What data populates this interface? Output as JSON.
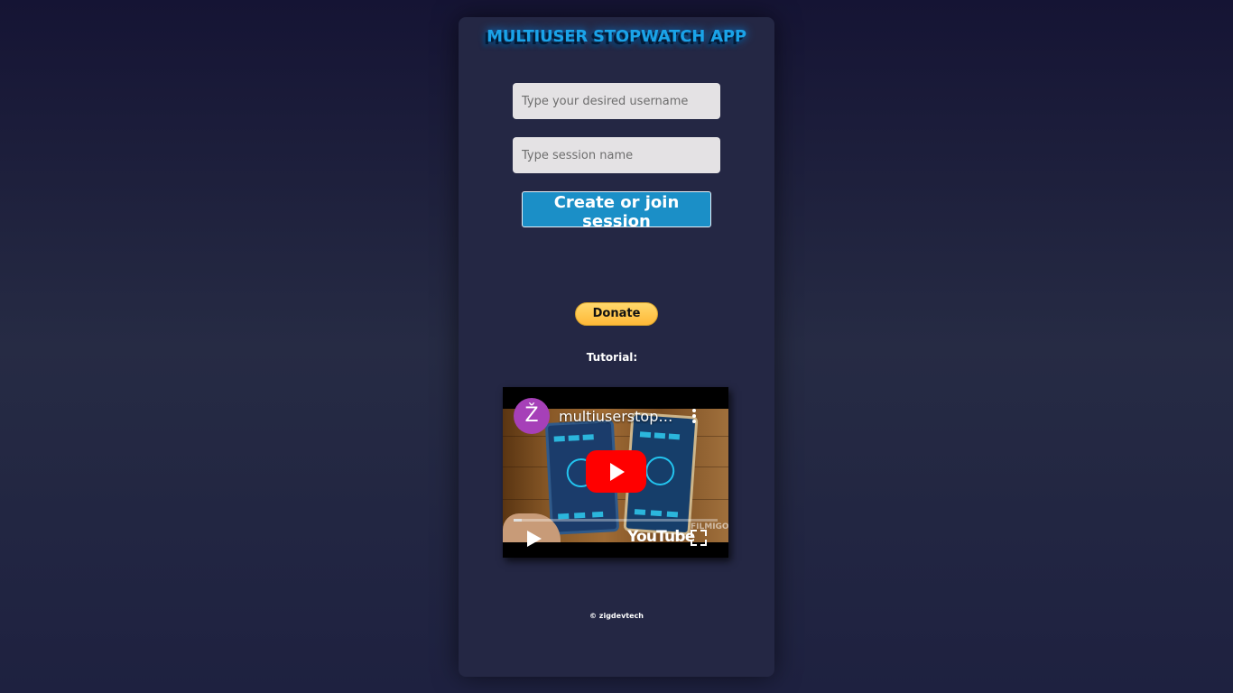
{
  "app": {
    "title": "MULTIUSER STOPWATCH APP"
  },
  "form": {
    "username_placeholder": "Type your desired username",
    "username_value": "",
    "session_placeholder": "Type session name",
    "session_value": "",
    "submit_label": "Create or join session"
  },
  "donate": {
    "label": "Donate"
  },
  "tutorial": {
    "label": "Tutorial:",
    "video": {
      "channel_initial": "Ž",
      "title": "multiuserstopwatch",
      "watermark": "FILMIGO",
      "platform": "YouTube",
      "progress_fraction": 0.04
    }
  },
  "footer": {
    "text": "© zigdevtech"
  },
  "colors": {
    "accent": "#1aa3e8",
    "button": "#1b8fc7",
    "donate": "#ffc43a",
    "play": "#ff0000",
    "panel": "#242744"
  },
  "icons": [
    "more-vert-icon",
    "play-icon",
    "fullscreen-icon",
    "youtube-logo"
  ]
}
